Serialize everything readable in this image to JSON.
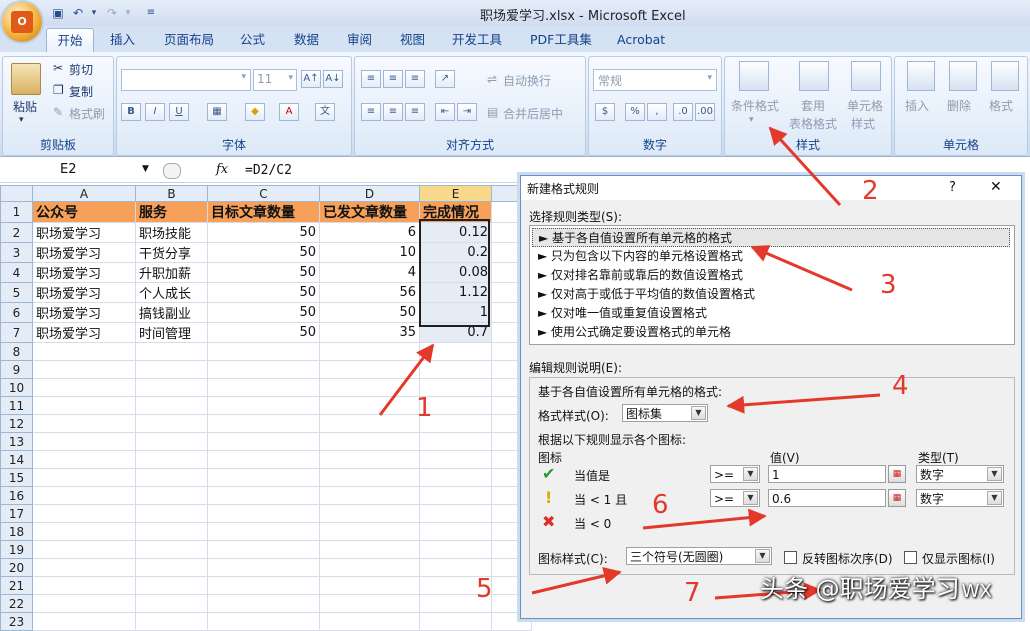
{
  "window": {
    "title": "职场爱学习.xlsx - Microsoft Excel"
  },
  "tabs": [
    "开始",
    "插入",
    "页面布局",
    "公式",
    "数据",
    "审阅",
    "视图",
    "开发工具",
    "PDF工具集",
    "Acrobat"
  ],
  "ribbon": {
    "clipboard": {
      "paste": "粘贴",
      "cut": "剪切",
      "copy": "复制",
      "format_painter": "格式刷",
      "label": "剪贴板"
    },
    "font": {
      "font_size": "11",
      "label": "字体"
    },
    "alignment": {
      "wrap": "自动换行",
      "merge": "合并后居中",
      "label": "对齐方式"
    },
    "number": {
      "format": "常规",
      "label": "数字"
    },
    "styles": {
      "cond_format_1": "条件格式",
      "table_format_1": "套用",
      "table_format_2": "表格格式",
      "cell_styles_1": "单元格",
      "cell_styles_2": "样式",
      "label": "样式"
    },
    "cells": {
      "insert": "插入",
      "delete": "删除",
      "format": "格式",
      "label": "单元格"
    }
  },
  "formula_bar": {
    "name_box": "E2",
    "fx": "fx",
    "formula": "=D2/C2"
  },
  "sheet": {
    "columns": [
      "A",
      "B",
      "C",
      "D",
      "E"
    ],
    "header": [
      "公众号",
      "服务",
      "目标文章数量",
      "已发文章数量",
      "完成情况"
    ],
    "rows": [
      [
        "职场爱学习",
        "职场技能",
        "50",
        "6",
        "0.12"
      ],
      [
        "职场爱学习",
        "干货分享",
        "50",
        "10",
        "0.2"
      ],
      [
        "职场爱学习",
        "升职加薪",
        "50",
        "4",
        "0.08"
      ],
      [
        "职场爱学习",
        "个人成长",
        "50",
        "56",
        "1.12"
      ],
      [
        "职场爱学习",
        "搞钱副业",
        "50",
        "50",
        "1"
      ],
      [
        "职场爱学习",
        "时间管理",
        "50",
        "35",
        "0.7"
      ]
    ],
    "row_numbers": [
      "1",
      "2",
      "3",
      "4",
      "5",
      "6",
      "7",
      "8",
      "9",
      "10",
      "11",
      "12",
      "13",
      "14",
      "15",
      "16",
      "17",
      "18",
      "19",
      "20",
      "21",
      "22",
      "23"
    ]
  },
  "dialog": {
    "title": "新建格式规则",
    "help": "?",
    "close": "✕",
    "select_rule_type": "选择规则类型(S):",
    "rule_types": [
      "基于各自值设置所有单元格的格式",
      "只为包含以下内容的单元格设置格式",
      "仅对排名靠前或靠后的数值设置格式",
      "仅对高于或低于平均值的数值设置格式",
      "仅对唯一值或重复值设置格式",
      "使用公式确定要设置格式的单元格"
    ],
    "edit_rule": "编辑规则说明(E):",
    "based_on": "基于各自值设置所有单元格的格式:",
    "format_style_label": "格式样式(O):",
    "format_style_value": "图标集",
    "display_rule": "根据以下规则显示各个图标:",
    "icon_header": "图标",
    "value_header": "值(V)",
    "type_header": "类型(T)",
    "rows": [
      {
        "cond": "当值是",
        "op": ">=",
        "value": "1",
        "type": "数字"
      },
      {
        "cond": "当 < 1 且",
        "op": ">=",
        "value": "0.6",
        "type": "数字"
      },
      {
        "cond": "当 < 0"
      }
    ],
    "icon_style_label": "图标样式(C):",
    "icon_style_value": "三个符号(无圆圈)",
    "reverse": "反转图标次序(D)",
    "show_icon_only": "仅显示图标(I)"
  },
  "annotations": [
    "1",
    "2",
    "3",
    "4",
    "5",
    "6",
    "7"
  ],
  "watermark": "头条 @职场爱学习",
  "watermark_tail": "WX",
  "colors": {
    "header_fill": "#f6a05a",
    "annotation": "#e3392b",
    "ribbon": "#d5e2f3"
  }
}
